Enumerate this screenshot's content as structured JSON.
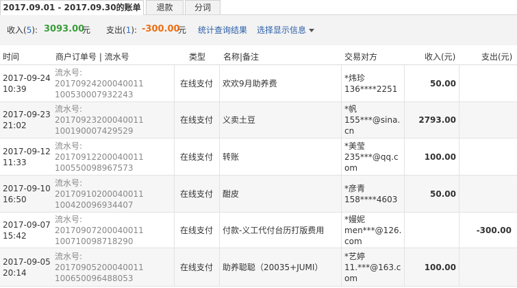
{
  "tabs": [
    {
      "label": "2017.09.01 - 2017.09.30的账单",
      "active": true
    },
    {
      "label": "退款",
      "active": false
    },
    {
      "label": "分词",
      "active": false
    }
  ],
  "summary": {
    "income_label": "收入(",
    "income_count": "5",
    "income_suffix": "):",
    "income_amount": "3093.00",
    "income_unit": "元",
    "expense_label": "支出(",
    "expense_count": "1",
    "expense_suffix": "):",
    "expense_amount": "-300.00",
    "expense_unit": "元",
    "stats_link": "统计查询结果",
    "display_link": "选择显示信息"
  },
  "table": {
    "headers": {
      "time": "时间",
      "order": "商户订单号 | 流水号",
      "type": "类型",
      "name": "名称|备注",
      "counterparty": "交易对方",
      "income": "收入(元)",
      "expense": "支出(元)"
    },
    "rows": [
      {
        "date": "2017-09-24",
        "time": "10:39",
        "serial_label": "流水号:",
        "serial_a": "20170924200040011",
        "serial_b": "100530007932243",
        "type": "在线支付",
        "name": "欢欢9月助养费",
        "cp_name": "*炜珍",
        "cp_account": "136****2251",
        "income": "50.00",
        "expense": ""
      },
      {
        "date": "2017-09-23",
        "time": "21:02",
        "serial_label": "流水号:",
        "serial_a": "20170923200040011",
        "serial_b": "100190007429529",
        "type": "在线支付",
        "name": "义卖土豆",
        "cp_name": "*帆",
        "cp_account": "155***@sina.cn",
        "income": "2793.00",
        "expense": ""
      },
      {
        "date": "2017-09-12",
        "time": "11:33",
        "serial_label": "流水号:",
        "serial_a": "20170912200040011",
        "serial_b": "100550098967573",
        "type": "在线支付",
        "name": "转账",
        "cp_name": "*美莹",
        "cp_account": "235***@qq.com",
        "income": "100.00",
        "expense": ""
      },
      {
        "date": "2017-09-10",
        "time": "16:50",
        "serial_label": "流水号:",
        "serial_a": "20170910200040011",
        "serial_b": "100420096934407",
        "type": "在线支付",
        "name": "酣皮",
        "cp_name": "*彦青",
        "cp_account": "158****4603",
        "income": "50.00",
        "expense": ""
      },
      {
        "date": "2017-09-07",
        "time": "15:42",
        "serial_label": "流水号:",
        "serial_a": "20170907200040011",
        "serial_b": "100710098718290",
        "type": "在线支付",
        "name": "付款-义工代付台历打版费用",
        "cp_name": "*嫚妮",
        "cp_account": "men***@126.com",
        "income": "",
        "expense": "-300.00"
      },
      {
        "date": "2017-09-05",
        "time": "20:14",
        "serial_label": "流水号:",
        "serial_a": "20170905200040011",
        "serial_b": "100650096488053",
        "type": "在线支付",
        "name": "助养聪聪（20035+JUMI）",
        "cp_name": "*艺婷",
        "cp_account": "11.***@163.com",
        "income": "100.00",
        "expense": ""
      }
    ]
  }
}
